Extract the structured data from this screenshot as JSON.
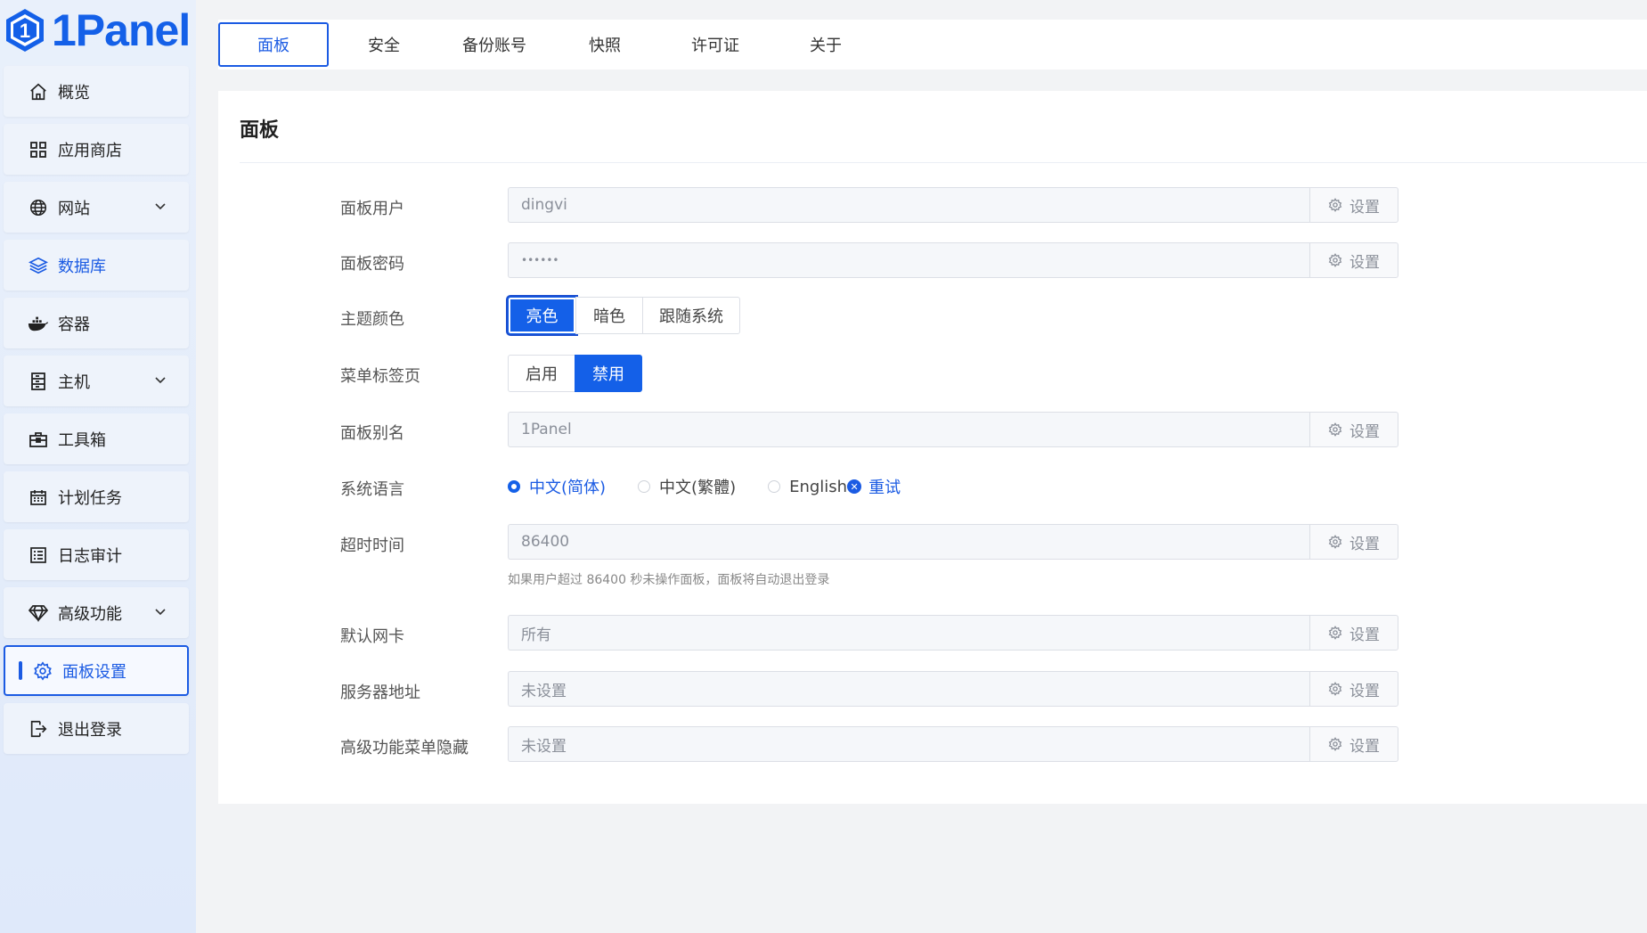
{
  "brand": {
    "name": "1Panel",
    "color": "#1460e8"
  },
  "sidebar": {
    "items": [
      {
        "label": "概览",
        "icon": "home-icon"
      },
      {
        "label": "应用商店",
        "icon": "grid-icon"
      },
      {
        "label": "网站",
        "icon": "globe-icon",
        "expandable": true
      },
      {
        "label": "数据库",
        "icon": "layers-icon"
      },
      {
        "label": "容器",
        "icon": "docker-icon"
      },
      {
        "label": "主机",
        "icon": "server-icon",
        "expandable": true
      },
      {
        "label": "工具箱",
        "icon": "toolbox-icon"
      },
      {
        "label": "计划任务",
        "icon": "calendar-icon"
      },
      {
        "label": "日志审计",
        "icon": "log-icon"
      },
      {
        "label": "高级功能",
        "icon": "diamond-icon",
        "expandable": true
      },
      {
        "label": "面板设置",
        "icon": "gear-icon",
        "active": true
      },
      {
        "label": "退出登录",
        "icon": "logout-icon"
      }
    ]
  },
  "tabs": [
    {
      "label": "面板",
      "active": true
    },
    {
      "label": "安全"
    },
    {
      "label": "备份账号"
    },
    {
      "label": "快照"
    },
    {
      "label": "许可证"
    },
    {
      "label": "关于"
    }
  ],
  "card": {
    "title": "面板",
    "set_label": "设置",
    "fields": {
      "user": {
        "label": "面板用户",
        "value": "dingvi"
      },
      "password": {
        "label": "面板密码",
        "value": "••••••"
      },
      "theme": {
        "label": "主题颜色",
        "options": [
          "亮色",
          "暗色",
          "跟随系统"
        ],
        "selected": "亮色"
      },
      "menu_tabs": {
        "label": "菜单标签页",
        "options": [
          "启用",
          "禁用"
        ],
        "selected": "禁用"
      },
      "alias": {
        "label": "面板别名",
        "value": "1Panel"
      },
      "language": {
        "label": "系统语言",
        "options": [
          "中文(简体)",
          "中文(繁體)",
          "English"
        ],
        "selected": "中文(简体)",
        "retry": "重试"
      },
      "timeout": {
        "label": "超时时间",
        "value": "86400",
        "hint": "如果用户超过 86400 秒未操作面板，面板将自动退出登录"
      },
      "nic": {
        "label": "默认网卡",
        "value": "所有"
      },
      "server_addr": {
        "label": "服务器地址",
        "value": "未设置"
      },
      "advanced_hide": {
        "label": "高级功能菜单隐藏",
        "value": "未设置"
      }
    }
  }
}
